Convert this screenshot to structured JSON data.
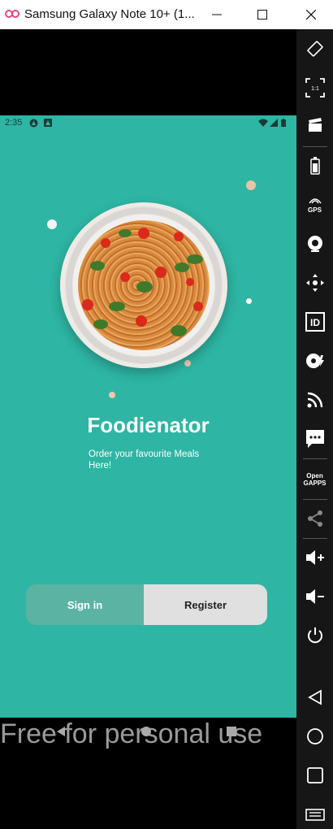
{
  "window": {
    "title": "Samsung Galaxy Note 10+ (1..."
  },
  "status_bar": {
    "time": "2:35"
  },
  "app": {
    "name": "Foodienator",
    "tagline": "Order your favourite Meals Here!",
    "sign_in_label": "Sign in",
    "register_label": "Register",
    "selected_tab": "Register",
    "colors": {
      "background": "#2eb5a3",
      "sign_in_bg": "#5bb3a4",
      "register_bg": "#e0e0e0"
    }
  },
  "watermark": {
    "text": "Free for personal use"
  },
  "sidebar": {
    "items": [
      {
        "icon": "rotate-icon"
      },
      {
        "icon": "pixel-perfect-icon",
        "label": "1:1"
      },
      {
        "icon": "screen-record-icon"
      },
      {
        "icon": "battery-icon"
      },
      {
        "icon": "gps-icon",
        "label": "GPS"
      },
      {
        "icon": "camera-icon"
      },
      {
        "icon": "dpad-icon"
      },
      {
        "icon": "identifiers-icon",
        "label": "ID"
      },
      {
        "icon": "disk-icon"
      },
      {
        "icon": "network-icon"
      },
      {
        "icon": "sms-icon"
      },
      {
        "icon": "open-gapps-icon",
        "label": "Open GAPPS"
      },
      {
        "icon": "share-icon"
      },
      {
        "icon": "volume-up-icon"
      },
      {
        "icon": "volume-down-icon"
      },
      {
        "icon": "power-icon"
      },
      {
        "icon": "back-icon"
      },
      {
        "icon": "home-icon"
      },
      {
        "icon": "recents-icon"
      },
      {
        "icon": "menu-icon"
      }
    ]
  }
}
